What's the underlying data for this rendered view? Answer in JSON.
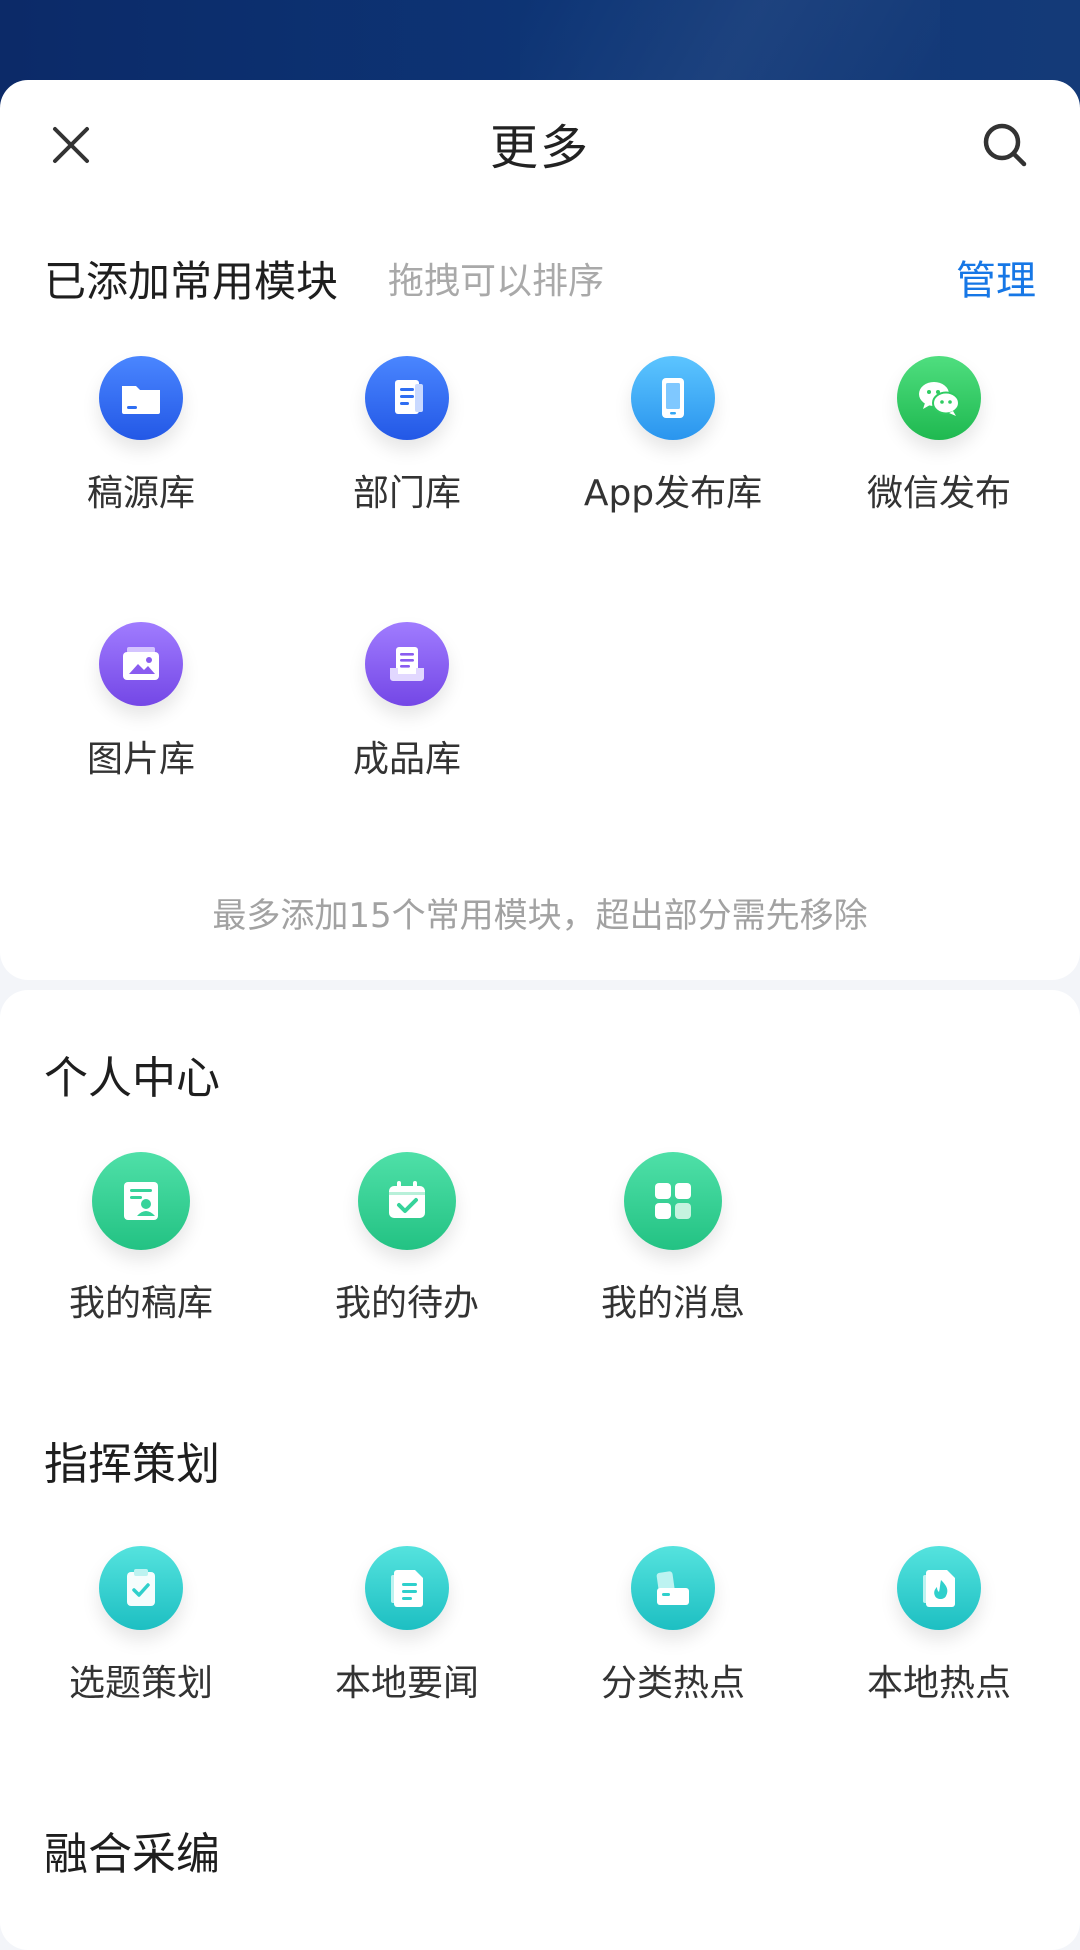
{
  "header": {
    "title": "更多"
  },
  "added_section": {
    "title": "已添加常用模块",
    "hint": "拖拽可以排序",
    "manage_label": "管理",
    "items": [
      {
        "label": "稿源库",
        "icon": "folder-icon",
        "color": "#2f6ef2"
      },
      {
        "label": "部门库",
        "icon": "document-icon",
        "color": "#2f6ef2"
      },
      {
        "label": "App发布库",
        "icon": "phone-icon",
        "color": "#35a7f4"
      },
      {
        "label": "微信发布",
        "icon": "wechat-icon",
        "color": "#2fcc62"
      },
      {
        "label": "图片库",
        "icon": "image-icon",
        "color": "#8a5cf0"
      },
      {
        "label": "成品库",
        "icon": "archive-icon",
        "color": "#8a5cf0"
      }
    ],
    "footnote": "最多添加15个常用模块，超出部分需先移除"
  },
  "personal_section": {
    "title": "个人中心",
    "items": [
      {
        "label": "我的稿库",
        "icon": "profile-card-icon",
        "color": "#36d39a"
      },
      {
        "label": "我的待办",
        "icon": "calendar-check-icon",
        "color": "#36d39a"
      },
      {
        "label": "我的消息",
        "icon": "grid-icon",
        "color": "#36d39a"
      }
    ]
  },
  "command_section": {
    "title": "指挥策划",
    "items": [
      {
        "label": "选题策划",
        "icon": "clipboard-check-icon",
        "color": "#2fd0cc"
      },
      {
        "label": "本地要闻",
        "icon": "news-icon",
        "color": "#2fd0cc"
      },
      {
        "label": "分类热点",
        "icon": "cards-icon",
        "color": "#2fd0cc"
      },
      {
        "label": "本地热点",
        "icon": "fire-file-icon",
        "color": "#2fd0cc"
      }
    ]
  },
  "fusion_section": {
    "title": "融合采编"
  }
}
